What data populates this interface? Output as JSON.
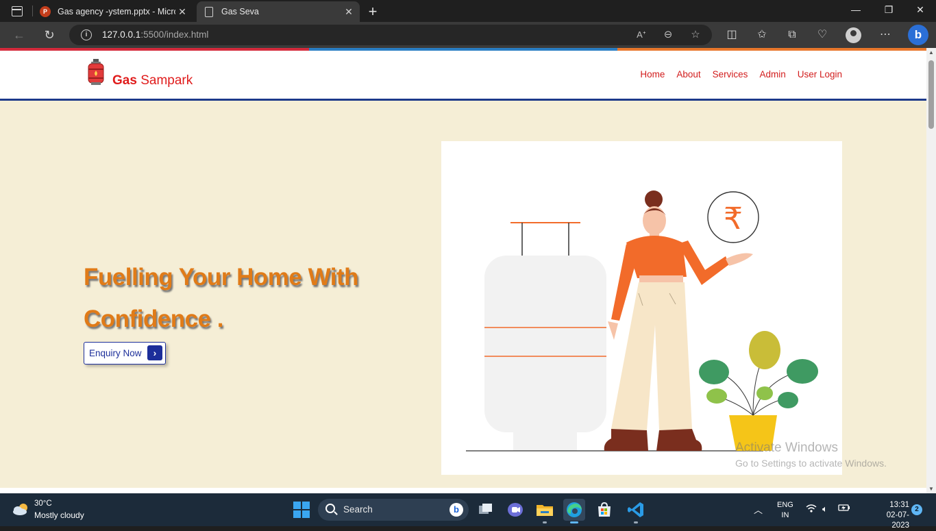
{
  "browser": {
    "tabs": [
      {
        "title": "Gas agency -ystem.pptx - Micros",
        "favicon": "powerpoint-icon",
        "active": false
      },
      {
        "title": "Gas Seva",
        "favicon": "page-icon",
        "active": true
      }
    ],
    "url": {
      "host": "127.0.0.1",
      "path": ":5500/index.html"
    }
  },
  "site": {
    "brand_bold": "Gas",
    "brand_rest": " Sampark",
    "nav": [
      "Home",
      "About",
      "Services",
      "Admin",
      "User Login"
    ],
    "hero_title_line1": "Fuelling Your Home With",
    "hero_title_line2": "Confidence .",
    "cta_label": "Enquiry Now",
    "colors": {
      "accent": "#e07b18",
      "brand": "#e01c1c",
      "primary": "#1c2e9a",
      "hero_bg": "#f5eed6"
    }
  },
  "watermark": {
    "line1": "Activate Windows",
    "line2": "Go to Settings to activate Windows."
  },
  "taskbar": {
    "weather_temp": "30°C",
    "weather_desc": "Mostly cloudy",
    "search_label": "Search",
    "lang_line1": "ENG",
    "lang_line2": "IN",
    "time": "13:31",
    "date": "02-07-2023",
    "notifications": "2"
  }
}
